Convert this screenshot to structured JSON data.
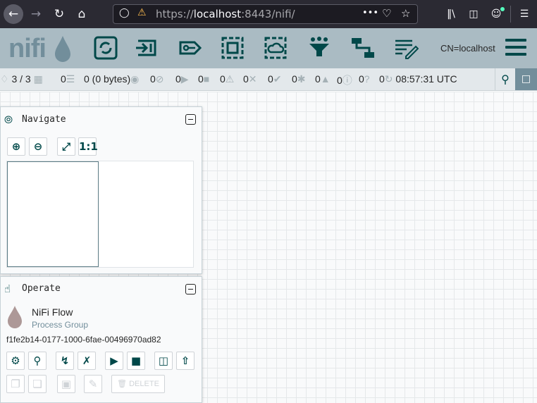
{
  "browser": {
    "url_prefix": "https://",
    "url_host": "localhost",
    "url_rest": ":8443/nifi/",
    "more": "•••"
  },
  "header": {
    "logo": "nifi",
    "user": "CN=localhost",
    "tools": [
      "processor-icon",
      "input-port-icon",
      "output-port-icon",
      "process-group-icon",
      "remote-process-group-icon",
      "funnel-icon",
      "template-icon",
      "label-icon"
    ]
  },
  "status": {
    "threads": "3 / 3",
    "queued_count": "0",
    "queued_size": "0 (0 bytes)",
    "transmitting": "0",
    "not_transmitting": "0",
    "running": "0",
    "stopped": "0",
    "invalid": "0",
    "disabled": "0",
    "up_to_date": "0",
    "locally_modified": "0",
    "stale": "0",
    "locally_modified_stale": "0",
    "sync_failure": "0",
    "last_refreshed": "08:57:31 UTC"
  },
  "navigate": {
    "title": "Navigate"
  },
  "operate": {
    "title": "Operate",
    "name": "NiFi Flow",
    "type": "Process Group",
    "id": "f1fe2b14-0177-1000-6fae-00496970ad82",
    "delete_label": "DELETE"
  },
  "colors": {
    "accent": "#004849",
    "header_bg": "#aabbc3",
    "status_bg": "#e3e8eb"
  }
}
